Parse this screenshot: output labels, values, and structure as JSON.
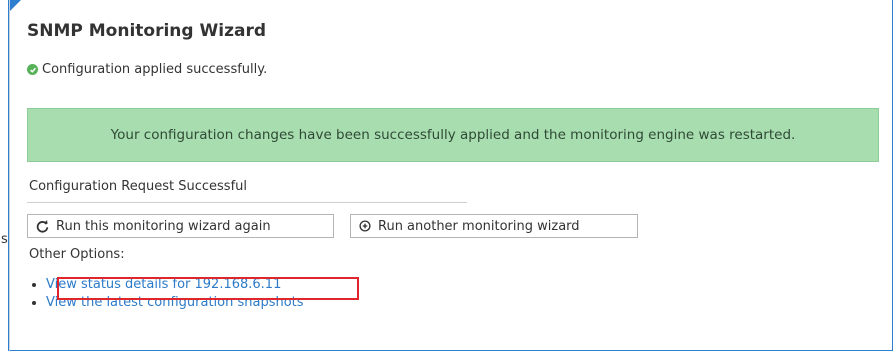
{
  "wizard": {
    "title": "SNMP Monitoring Wizard",
    "status_message": "Configuration applied successfully.",
    "alert_message": "Your configuration changes have been successfully applied and the monitoring engine was restarted.",
    "request_header": "Configuration Request Successful",
    "buttons": {
      "run_again_label": "Run this monitoring wizard again",
      "run_another_label": "Run another monitoring wizard"
    },
    "other_options_label": "Other Options:",
    "options": [
      "View status details for 192.168.6.11",
      "View the latest configuration snapshots"
    ],
    "edge_glyph": "s"
  },
  "colors": {
    "accent": "#2f7fd0",
    "success_bg": "#a8ddb0",
    "link": "#2d7bc8",
    "highlight": "#e0262d",
    "check": "#58b25a"
  },
  "icons": [
    "check-circle-icon",
    "refresh-icon",
    "plus-circle-icon"
  ]
}
